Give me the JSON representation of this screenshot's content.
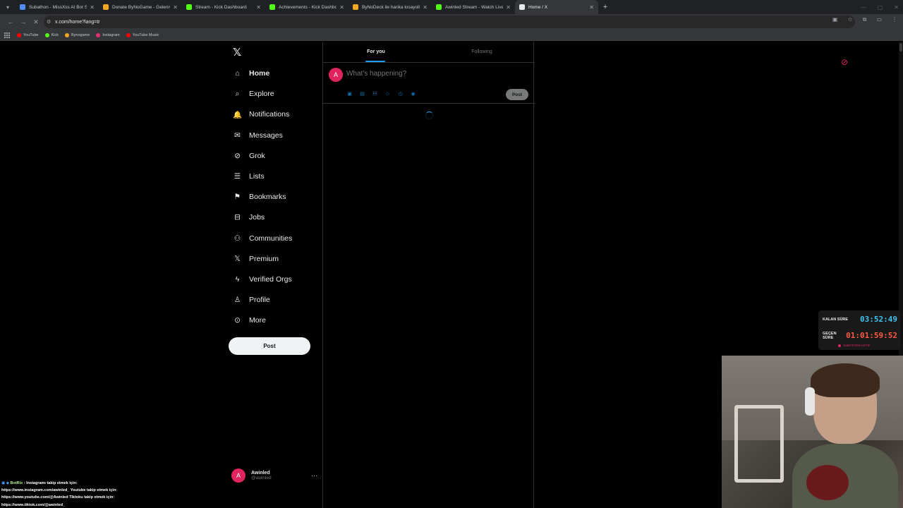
{
  "browser": {
    "tabs": [
      {
        "title": "Subathon - MissXss AI Bot Syst",
        "color": "#4f8df5",
        "active": false
      },
      {
        "title": "Donate ByNoGame - Gelen/Gi",
        "color": "#f5a623",
        "active": false
      },
      {
        "title": "Stream - Kick Dashboard",
        "color": "#53fc18",
        "active": false
      },
      {
        "title": "Achievements - Kick Dashboard",
        "color": "#53fc18",
        "active": false
      },
      {
        "title": "ByNoDeck ile harika kısayollar",
        "color": "#f5a623",
        "active": false
      },
      {
        "title": "Awinled Stream - Watch Live o",
        "color": "#53fc18",
        "active": false
      },
      {
        "title": "Home / X",
        "color": "#e7e9ea",
        "active": true
      }
    ],
    "url": "x.com/home?lang=tr",
    "bookmarks": [
      {
        "label": "YouTube",
        "color": "#ff0000"
      },
      {
        "label": "Kick",
        "color": "#53fc18"
      },
      {
        "label": "Bynogame",
        "color": "#f5a623"
      },
      {
        "label": "Instagram",
        "color": "#e1306c"
      },
      {
        "label": "YouTube Music",
        "color": "#ff0000"
      }
    ]
  },
  "sidebar": {
    "items": [
      {
        "label": "Home",
        "icon": "home-icon",
        "glyph": "⌂"
      },
      {
        "label": "Explore",
        "icon": "search-icon",
        "glyph": "⌕"
      },
      {
        "label": "Notifications",
        "icon": "bell-icon",
        "glyph": "🔔"
      },
      {
        "label": "Messages",
        "icon": "envelope-icon",
        "glyph": "✉"
      },
      {
        "label": "Grok",
        "icon": "grok-icon",
        "glyph": "⊘"
      },
      {
        "label": "Lists",
        "icon": "list-icon",
        "glyph": "☰"
      },
      {
        "label": "Bookmarks",
        "icon": "bookmark-icon",
        "glyph": "⚑"
      },
      {
        "label": "Jobs",
        "icon": "briefcase-icon",
        "glyph": "⊟"
      },
      {
        "label": "Communities",
        "icon": "people-icon",
        "glyph": "⚇"
      },
      {
        "label": "Premium",
        "icon": "x-icon",
        "glyph": "𝕏"
      },
      {
        "label": "Verified Orgs",
        "icon": "lightning-icon",
        "glyph": "ϟ"
      },
      {
        "label": "Profile",
        "icon": "person-icon",
        "glyph": "♙"
      },
      {
        "label": "More",
        "icon": "more-circle-icon",
        "glyph": "⊙"
      }
    ],
    "post_label": "Post",
    "account": {
      "name": "Awinled",
      "handle": "@awinled",
      "initial": "A"
    }
  },
  "feed": {
    "tabs": [
      "For you",
      "Following"
    ],
    "composer_placeholder": "What's happening?",
    "composer_post_label": "Post"
  },
  "overlay": {
    "timer": {
      "remaining_label": "KALAN SÜRE",
      "remaining_value": "03:52:49",
      "remaining_color": "#3fc3f0",
      "elapsed_label": "GEÇEN SÜRE",
      "elapsed_value": "01:01:59:52",
      "elapsed_color": "#ff5a3c",
      "status": "SUBATHON AKTİF"
    },
    "chat": {
      "user": "BotRix",
      "lines": [
        "Instagramı takip etmek için:",
        "https://www.instagram.com/awinled_ Youtube takip etmek için:",
        "https://www.youtube.com/@Awinled Tiktoku takip etmek için:",
        "https://www.tiktok.com/@awinled_"
      ]
    }
  }
}
